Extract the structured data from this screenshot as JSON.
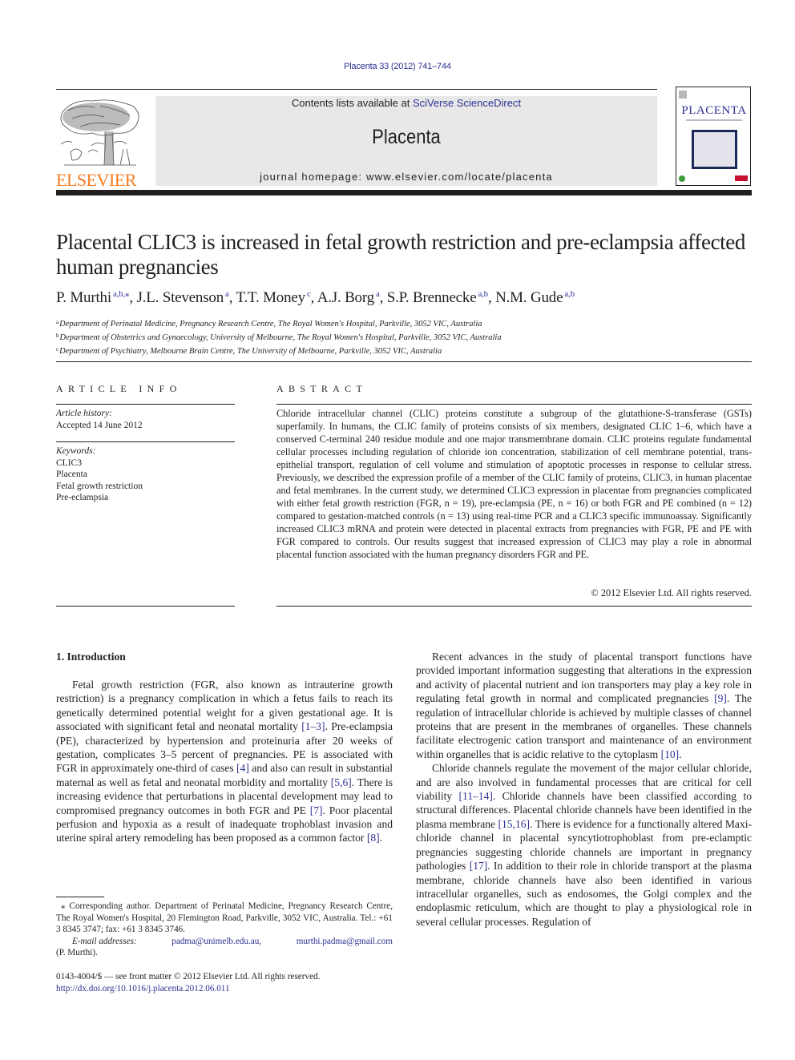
{
  "header": {
    "journal_reference": "Placenta 33 (2012) 741–744",
    "contents_prefix": "Contents lists available at ",
    "contents_link": "SciVerse ScienceDirect",
    "journal_name": "Placenta",
    "homepage": "journal homepage: www.elsevier.com/locate/placenta",
    "publisher_logo_text": "ELSEVIER",
    "cover_title": "PLACENTA"
  },
  "colors": {
    "link": "#2e3192",
    "elsevier_orange": "#f47b20",
    "band_gray": "#e8e8e8",
    "text": "#231f20"
  },
  "article": {
    "title": "Placental CLIC3 is increased in fetal growth restriction and pre-eclampsia affected human pregnancies",
    "authors": [
      {
        "name": "P. Murthi",
        "affil": "a,b,⁎"
      },
      {
        "name": "J.L. Stevenson",
        "affil": "a"
      },
      {
        "name": "T.T. Money",
        "affil": "c"
      },
      {
        "name": "A.J. Borg",
        "affil": "a"
      },
      {
        "name": "S.P. Brennecke",
        "affil": "a,b"
      },
      {
        "name": "N.M. Gude",
        "affil": "a,b"
      }
    ],
    "author_separator": ", ",
    "affiliations": [
      {
        "key": "a",
        "text": "Department of Perinatal Medicine, Pregnancy Research Centre, The Royal Women's Hospital, Parkville, 3052 VIC, Australia"
      },
      {
        "key": "b",
        "text": "Department of Obstetrics and Gynaecology, University of Melbourne, The Royal Women's Hospital, Parkville, 3052 VIC, Australia"
      },
      {
        "key": "c",
        "text": "Department of Psychiatry, Melbourne Brain Centre, The University of Melbourne, Parkville, 3052 VIC, Australia"
      }
    ]
  },
  "article_info": {
    "heading": "ARTICLE INFO",
    "history_label": "Article history:",
    "history_value": "Accepted 14 June 2012",
    "keywords_label": "Keywords:",
    "keywords": [
      "CLIC3",
      "Placenta",
      "Fetal growth restriction",
      "Pre-eclampsia"
    ]
  },
  "abstract": {
    "heading": "ABSTRACT",
    "text": "Chloride intracellular channel (CLIC) proteins constitute a subgroup of the glutathione-S-transferase (GSTs) superfamily. In humans, the CLIC family of proteins consists of six members, designated CLIC 1–6, which have a conserved C-terminal 240 residue module and one major transmembrane domain. CLIC proteins regulate fundamental cellular processes including regulation of chloride ion concentration, stabilization of cell membrane potential, trans-epithelial transport, regulation of cell volume and stimulation of apoptotic processes in response to cellular stress. Previously, we described the expression profile of a member of the CLIC family of proteins, CLIC3, in human placentae and fetal membranes. In the current study, we determined CLIC3 expression in placentae from pregnancies complicated with either fetal growth restriction (FGR, n = 19), pre-eclampsia (PE, n = 16) or both FGR and PE combined (n = 12) compared to gestation-matched controls (n = 13) using real-time PCR and a CLIC3 specific immunoassay. Significantly increased CLIC3 mRNA and protein were detected in placental extracts from pregnancies with FGR, PE and PE with FGR compared to controls. Our results suggest that increased expression of CLIC3 may play a role in abnormal placental function associated with the human pregnancy disorders FGR and PE.",
    "copyright": "© 2012 Elsevier Ltd. All rights reserved."
  },
  "body": {
    "section_heading": "1.  Introduction",
    "left_paragraphs": [
      [
        {
          "t": "Fetal growth restriction (FGR, also known as intrauterine growth restriction) is a pregnancy complication in which a fetus fails to reach its genetically determined potential weight for a given gestational age. It is associated with significant fetal and neonatal mortality "
        },
        {
          "c": "[1–3]"
        },
        {
          "t": ". Pre-eclampsia (PE), characterized by hypertension and proteinuria after 20 weeks of gestation, complicates 3–5 percent of pregnancies. PE is associated with FGR in approximately one-third of cases "
        },
        {
          "c": "[4]"
        },
        {
          "t": " and also can result in substantial maternal as well as fetal and neonatal morbidity and mortality "
        },
        {
          "c": "[5,6]"
        },
        {
          "t": ". There is increasing evidence that perturbations in placental development may lead to compromised pregnancy outcomes in both FGR and PE "
        },
        {
          "c": "[7]"
        },
        {
          "t": ". Poor placental perfusion and hypoxia as a result of inadequate trophoblast invasion and uterine spiral artery remodeling has been proposed as a common factor "
        },
        {
          "c": "[8]"
        },
        {
          "t": "."
        }
      ]
    ],
    "right_paragraphs": [
      [
        {
          "t": "Recent advances in the study of placental transport functions have provided important information suggesting that alterations in the expression and activity of placental nutrient and ion transporters may play a key role in regulating fetal growth in normal and complicated pregnancies "
        },
        {
          "c": "[9]"
        },
        {
          "t": ". The regulation of intracellular chloride is achieved by multiple classes of channel proteins that are present in the membranes of organelles. These channels facilitate electrogenic cation transport and maintenance of an environment within organelles that is acidic relative to the cytoplasm "
        },
        {
          "c": "[10]"
        },
        {
          "t": "."
        }
      ],
      [
        {
          "t": "Chloride channels regulate the movement of the major cellular chloride, and are also involved in fundamental processes that are critical for cell viability "
        },
        {
          "c": "[11–14]"
        },
        {
          "t": ". Chloride channels have been classified according to structural differences. Placental chloride channels have been identified in the plasma membrane "
        },
        {
          "c": "[15,16]"
        },
        {
          "t": ". There is evidence for a functionally altered Maxi-chloride channel in placental syncytiotrophoblast from pre-eclamptic pregnancies suggesting chloride channels are important in pregnancy pathologies "
        },
        {
          "c": "[17]"
        },
        {
          "t": ". In addition to their role in chloride transport at the plasma membrane, chloride channels have also been identified in various intracellular organelles, such as endosomes, the Golgi complex and the endoplasmic reticulum, which are thought to play a physiological role in several cellular processes. Regulation of"
        }
      ]
    ]
  },
  "footnotes": {
    "corresponding": "⁎ Corresponding author. Department of Perinatal Medicine, Pregnancy Research Centre, The Royal Women's Hospital, 20 Flemington Road, Parkville, 3052 VIC, Australia. Tel.: +61 3 8345 3747; fax: +61 3 8345 3746.",
    "email_label": "E-mail addresses:",
    "email_1": "padma@unimelb.edu.au,",
    "email_2": "murthi.padma@gmail.com",
    "email_owner": "(P. Murthi)."
  },
  "front_matter": {
    "issn_line": "0143-4004/$ — see front matter © 2012 Elsevier Ltd. All rights reserved.",
    "doi": "http://dx.doi.org/10.1016/j.placenta.2012.06.011"
  }
}
